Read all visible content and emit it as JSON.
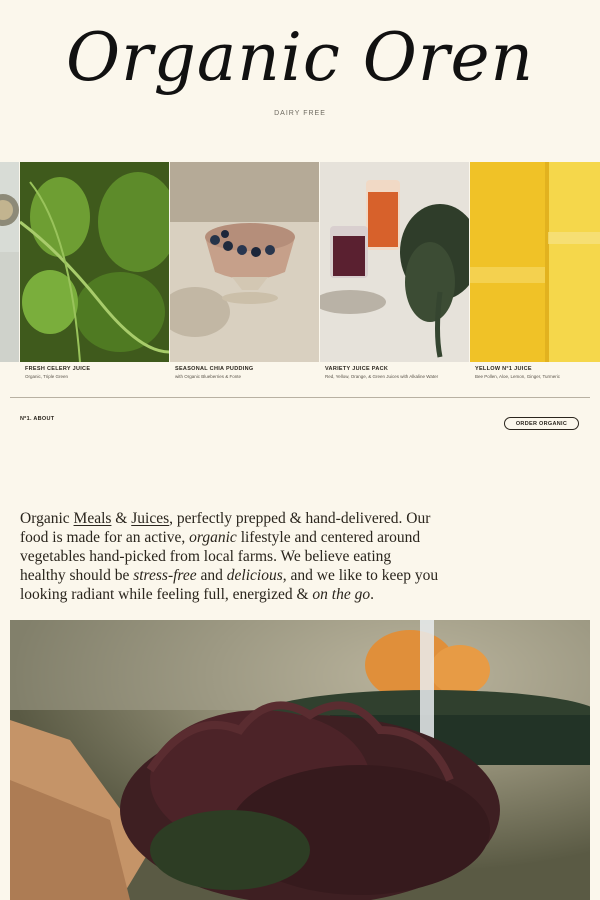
{
  "brand": {
    "name": "Organic Oren",
    "tagline": "DAIRY FREE"
  },
  "carousel": {
    "items": [
      {
        "title": "FRESH CELERY JUICE",
        "subtitle": "Organic, Triple Green"
      },
      {
        "title": "SEASONAL CHIA PUDDING",
        "subtitle": "with Organic Blueberries & Fonte"
      },
      {
        "title": "VARIETY JUICE PACK",
        "subtitle": "Red, Yellow, Orange, & Green Juices with Alkaline Water"
      },
      {
        "title": "YELLOW N°1 JUICE",
        "subtitle": "Bee Pollen, Aloe, Lemon, Ginger, Turmeric"
      }
    ]
  },
  "section": {
    "label": "Nº1. ABOUT",
    "cta": "ORDER ORGANIC"
  },
  "about": {
    "p1": "Organic ",
    "meals": "Meals",
    "amp1": " & ",
    "juices": "Juices",
    "p2": ", perfectly prepped & hand-delivered. Our food is made for an active, ",
    "organic": "organic",
    "p3": " lifestyle and centered around vegetables hand-picked from local farms. We believe eating healthy should be ",
    "stressfree": "stress-free",
    "p4": " and ",
    "delicious": "delicious",
    "p5": ", and we like to keep you looking radiant while feeling full, energized & ",
    "onthego": "on the go",
    "p6": "."
  },
  "colors": {
    "background": "#fbf7ec",
    "text": "#2a251d"
  }
}
